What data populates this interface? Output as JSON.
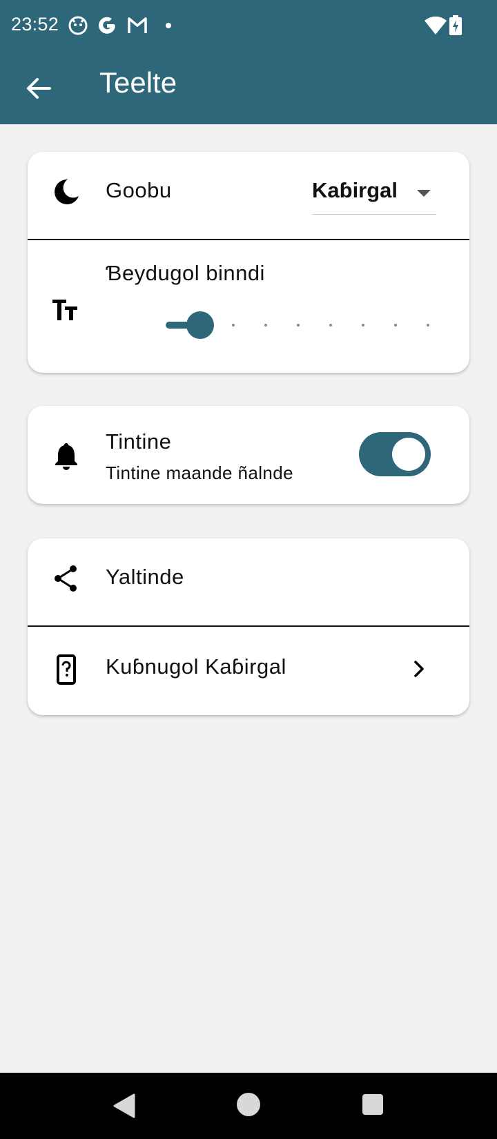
{
  "status_bar": {
    "time": "23:52",
    "icons": [
      "cat-notification-icon",
      "google-icon",
      "gmail-icon",
      "dot-icon",
      "wifi-icon",
      "battery-charging-icon"
    ]
  },
  "app_bar": {
    "title": "Teelte",
    "back_icon": "arrow-back-icon"
  },
  "settings": {
    "theme": {
      "icon": "moon-icon",
      "label": "Goobu",
      "value": "Kaɓirgal"
    },
    "font_size": {
      "icon": "text-size-icon",
      "label": "Ɓeydugol binndi",
      "level": 1,
      "steps": 9
    },
    "notifications": {
      "icon": "bell-icon",
      "label": "Tintine",
      "subtitle": "Tintine maande ñalnde",
      "enabled": true
    },
    "share": {
      "icon": "share-icon",
      "label": "Yaltinde"
    },
    "help": {
      "icon": "help-device-icon",
      "label": "Kuɓnugol Kaɓirgal"
    }
  },
  "colors": {
    "primary": "#2d6779",
    "background": "#f1f1f1",
    "card": "#ffffff"
  },
  "nav_bar": {
    "icons": [
      "back-triangle-icon",
      "home-circle-icon",
      "recents-square-icon"
    ]
  }
}
